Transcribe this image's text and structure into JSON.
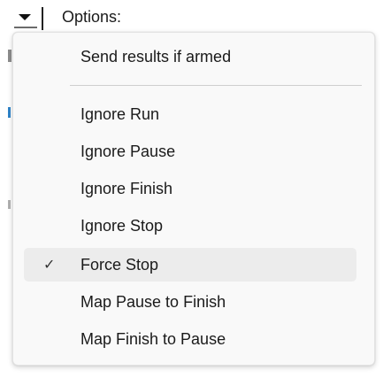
{
  "trigger": {
    "label": "Options:"
  },
  "menu": {
    "items": [
      {
        "label": "Send results if armed",
        "checked": false
      },
      {
        "label": "Ignore Run",
        "checked": false
      },
      {
        "label": "Ignore Pause",
        "checked": false
      },
      {
        "label": "Ignore Finish",
        "checked": false
      },
      {
        "label": "Ignore Stop",
        "checked": false
      },
      {
        "label": "Force Stop",
        "checked": true,
        "highlighted": true
      },
      {
        "label": "Map Pause to Finish",
        "checked": false
      },
      {
        "label": "Map Finish to Pause",
        "checked": false
      }
    ],
    "check_glyph": "✓",
    "check_icon": "check-mark-icon"
  },
  "colors": {
    "menu_background": "#f9f9f9",
    "highlight_background": "#ececec",
    "separator": "#cfcfcf",
    "text": "#1a1a1a"
  }
}
